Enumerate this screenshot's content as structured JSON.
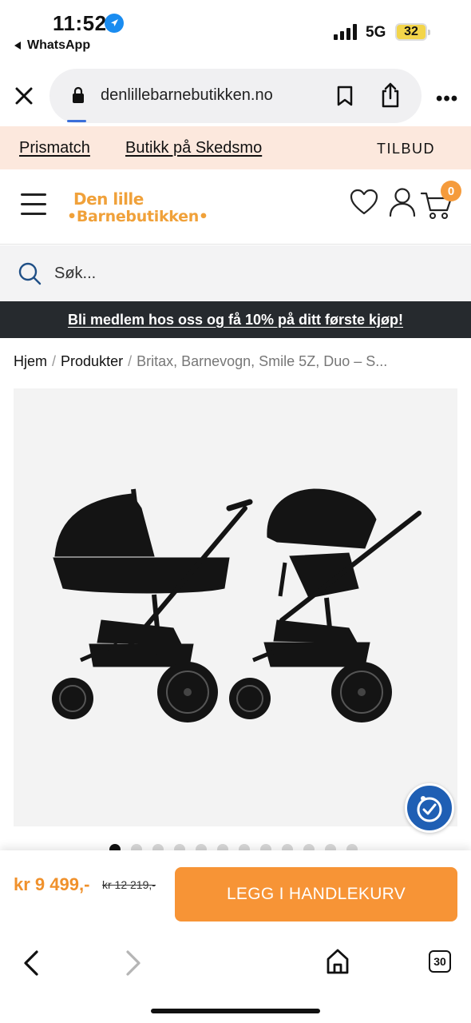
{
  "status_bar": {
    "time": "11:52",
    "back_app": "WhatsApp",
    "network": "5G",
    "battery": "32"
  },
  "browser": {
    "url": "denlillebarnebutikken.no",
    "tab_count": "30"
  },
  "promo": {
    "links": [
      "Prismatch",
      "Butikk på Skedsmo"
    ],
    "tilbud": "TILBUD"
  },
  "header": {
    "logo_line1": "Den lille",
    "logo_line2": "•Barnebutikken•",
    "cart_count": "0",
    "accent_color": "#f0a13a"
  },
  "search": {
    "placeholder": "Søk..."
  },
  "member_banner": {
    "text": "Bli medlem hos oss og få 10% på ditt første kjøp!"
  },
  "breadcrumb": {
    "home": "Hjem",
    "products": "Produkter",
    "current": "Britax, Barnevogn, Smile 5Z, Duo – S..."
  },
  "gallery": {
    "total_images": 12,
    "active_index": 0
  },
  "purchase": {
    "price": "kr 9 499,-",
    "old_price": "kr 12 219,-",
    "add_to_cart": "LEGG I HANDLEKURV",
    "button_color": "#f79436"
  }
}
